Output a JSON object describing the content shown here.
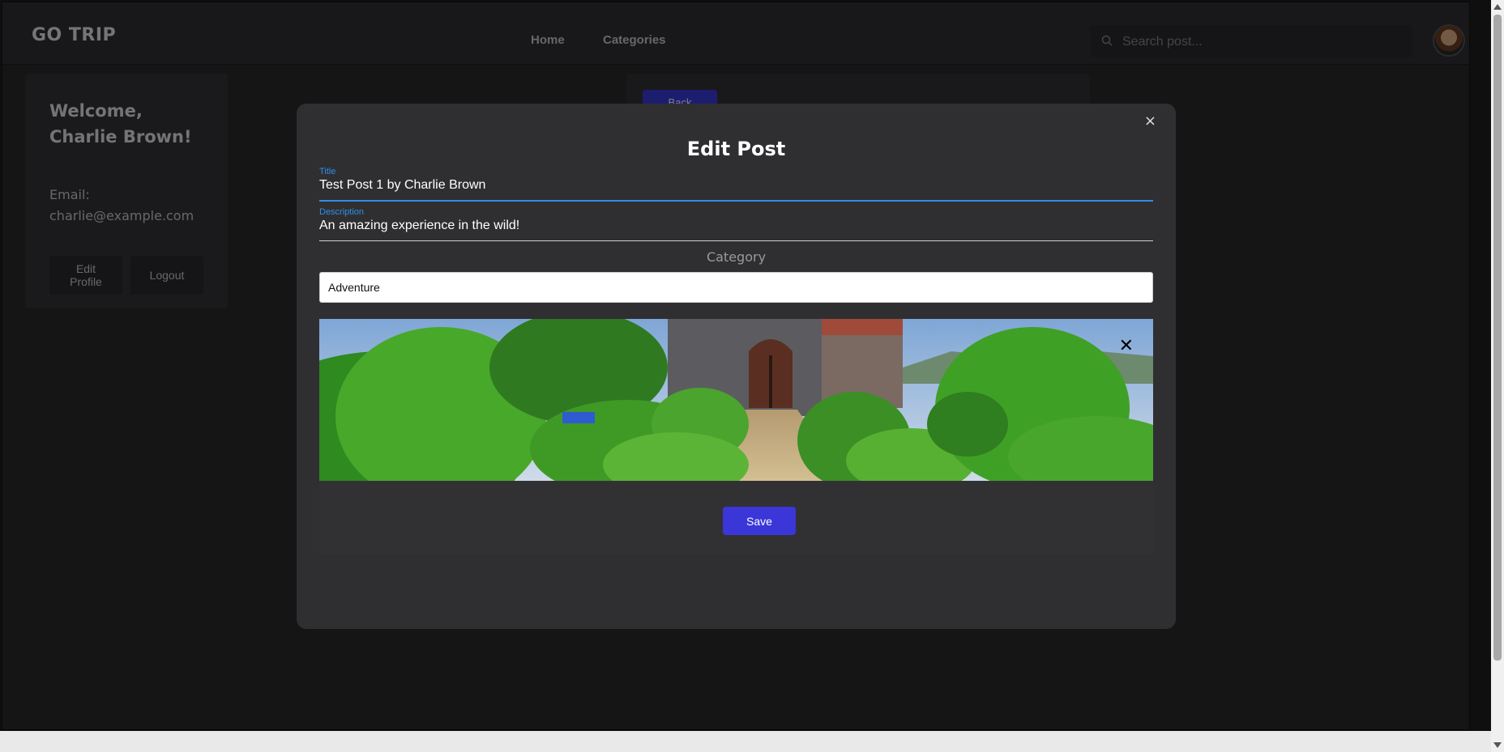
{
  "navbar": {
    "brand": "GO TRIP",
    "links": [
      "Home",
      "Categories"
    ],
    "search_placeholder": "Search post..."
  },
  "profile": {
    "welcome": "Welcome, Charlie Brown!",
    "email_label": "Email:",
    "email": "charlie@example.com",
    "edit_label": "Edit Profile",
    "logout_label": "Logout"
  },
  "post": {
    "back_label": "Back"
  },
  "modal": {
    "close": "×",
    "title": "Edit Post",
    "title_field": {
      "label": "Title",
      "value": "Test Post 1 by Charlie Brown"
    },
    "description_field": {
      "label": "Description",
      "value": "An amazing experience in the wild!"
    },
    "category_label": "Category",
    "category_value": "Adventure",
    "remove_image": "✕",
    "save_label": "Save"
  },
  "colors": {
    "accent": "#3a36d8",
    "field_focus": "#2f8fe8"
  }
}
